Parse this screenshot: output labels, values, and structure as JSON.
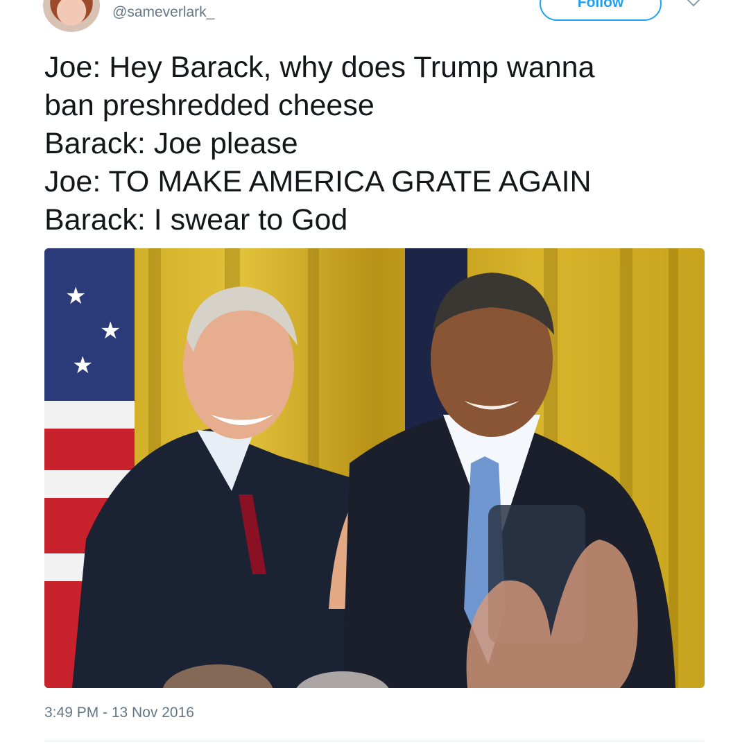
{
  "user": {
    "handle": "@sameverlark_"
  },
  "header": {
    "follow_label": "Follow"
  },
  "tweet": {
    "lines": [
      "Joe: Hey Barack, why does Trump wanna",
      "ban preshredded cheese",
      "Barack: Joe please",
      "Joe: TO MAKE AMERICA GRATE AGAIN",
      "Barack: I swear to God"
    ],
    "timestamp": "3:49 PM - 13 Nov 2016"
  },
  "icons": {
    "avatar": "profile-avatar",
    "menu": "chevron-down-icon"
  },
  "colors": {
    "accent": "#1da1f2",
    "text": "#14171a",
    "muted": "#657786"
  }
}
